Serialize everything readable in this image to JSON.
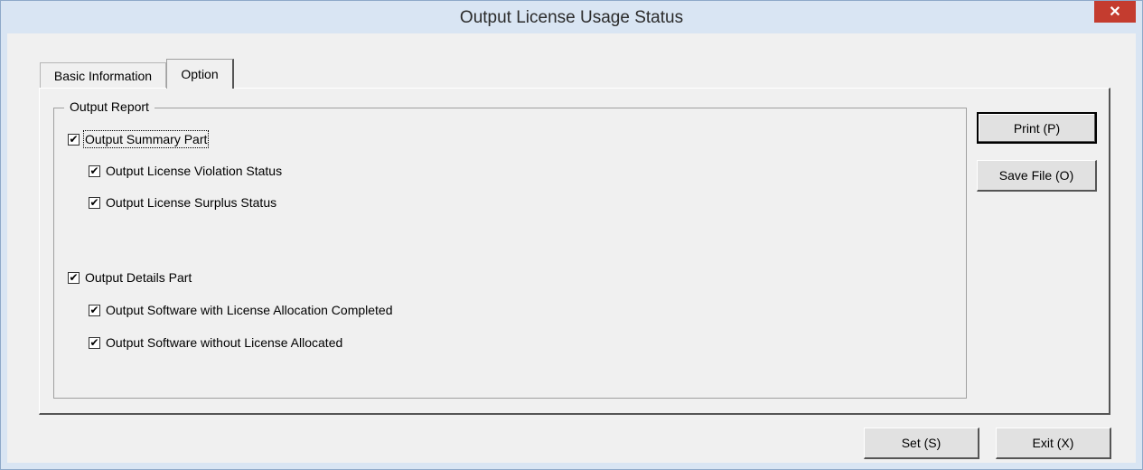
{
  "window": {
    "title": "Output License Usage Status",
    "close_symbol": "✕"
  },
  "tabs": [
    {
      "label": "Basic Information",
      "active": false
    },
    {
      "label": "Option",
      "active": true
    }
  ],
  "output_report": {
    "legend": "Output Report",
    "options": [
      {
        "label": "Output Summary Part",
        "checked": true
      },
      {
        "label": "Output License Violation Status",
        "checked": true
      },
      {
        "label": "Output License Surplus Status",
        "checked": true
      },
      {
        "label": "Output Details Part",
        "checked": true
      },
      {
        "label": "Output Software with License Allocation Completed",
        "checked": true
      },
      {
        "label": "Output Software without License Allocated",
        "checked": true
      }
    ]
  },
  "side_buttons": {
    "print": "Print (P)",
    "save_file": "Save File (O)"
  },
  "footer_buttons": {
    "set": "Set (S)",
    "exit": "Exit (X)"
  },
  "check_glyph": "✔",
  "colors": {
    "titlebar": "#d9e5f3",
    "close_button": "#c43c2f",
    "dialog_bg": "#f0f0f0"
  }
}
